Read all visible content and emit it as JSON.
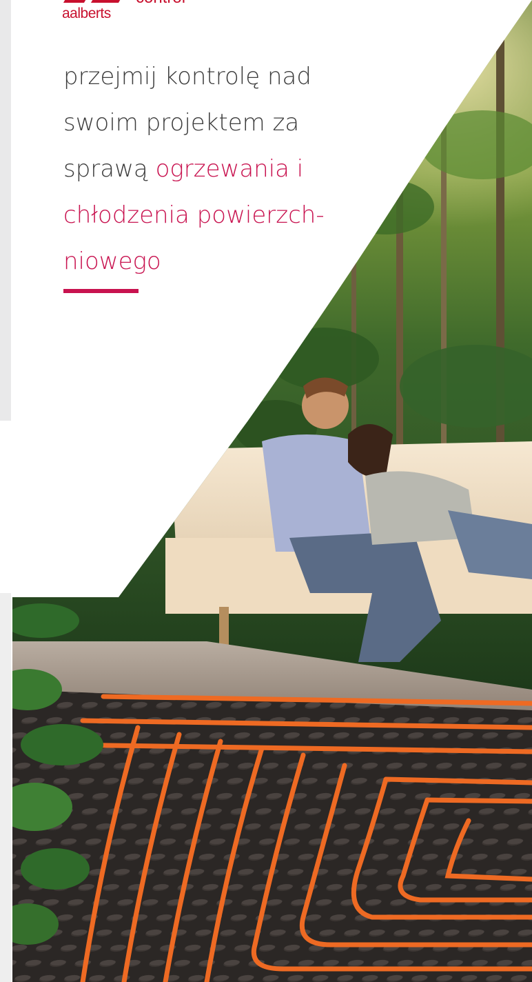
{
  "brand": {
    "name": "aalberts",
    "suffix": "control",
    "color": "#c8102e"
  },
  "headline": {
    "line1": "przejmij kontrolę nad",
    "line2": "swoim projektem za",
    "line3_plain": "sprawą ",
    "line3_accent": "ogrzewania i",
    "line4": "chłodzenia powierzch-",
    "line5": "niowego",
    "text_color": "#3c3c3c",
    "accent_color": "#c8124f"
  },
  "images": {
    "hero": "couple-on-sofa-in-jungle-photo",
    "floor": "underfloor-heating-pipes-photo"
  }
}
